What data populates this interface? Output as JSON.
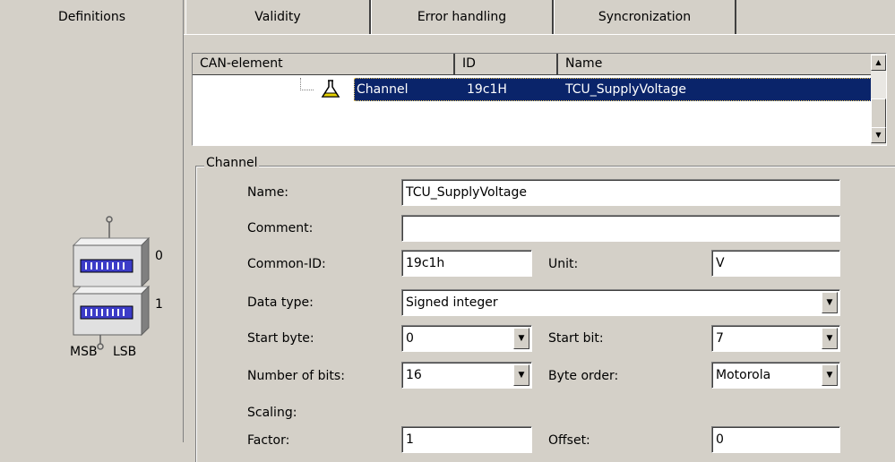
{
  "tabs": [
    {
      "label": "Definitions",
      "active": true
    },
    {
      "label": "Validity",
      "active": false
    },
    {
      "label": "Error handling",
      "active": false
    },
    {
      "label": "Syncronization",
      "active": false
    }
  ],
  "list": {
    "columns": [
      "CAN-element",
      "ID",
      "Name"
    ],
    "rows": [
      {
        "element": "Channel",
        "id": "19c1H",
        "name": "TCU_SupplyVoltage",
        "icon": "flask-icon",
        "selected": true
      }
    ]
  },
  "diagram": {
    "byte0": "0",
    "byte1": "1",
    "msb": "MSB",
    "lsb": "LSB"
  },
  "channel": {
    "group_title": "Channel",
    "name_label": "Name:",
    "name_value": "TCU_SupplyVoltage",
    "comment_label": "Comment:",
    "comment_value": "",
    "common_id_label": "Common-ID:",
    "common_id_value": "19c1h",
    "unit_label": "Unit:",
    "unit_value": "V",
    "data_type_label": "Data type:",
    "data_type_value": "Signed integer",
    "start_byte_label": "Start byte:",
    "start_byte_value": "0",
    "start_bit_label": "Start bit:",
    "start_bit_value": "7",
    "num_bits_label": "Number of bits:",
    "num_bits_value": "16",
    "byte_order_label": "Byte order:",
    "byte_order_value": "Motorola",
    "scaling_label": "Scaling:",
    "factor_label": "Factor:",
    "factor_value": "1",
    "offset_label": "Offset:",
    "offset_value": "0"
  },
  "colors": {
    "selection": "#0a246a",
    "face": "#d4d0c8",
    "chip": "#3c3cc8"
  }
}
